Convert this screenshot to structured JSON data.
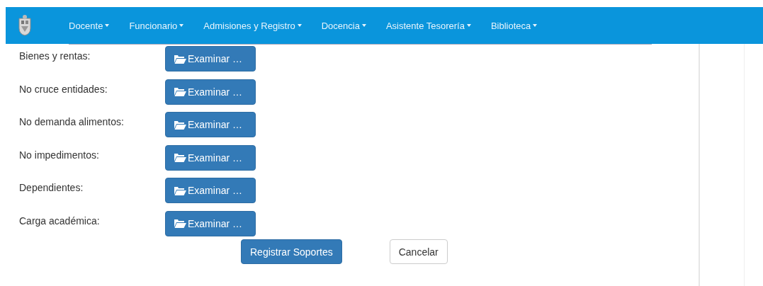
{
  "navbar": {
    "menus": [
      {
        "label": "Docente"
      },
      {
        "label": "Funcionario"
      },
      {
        "label": "Admisiones y Registro"
      },
      {
        "label": "Docencia"
      },
      {
        "label": "Asistente Tesorería"
      },
      {
        "label": "Biblioteca"
      }
    ]
  },
  "form": {
    "rows": [
      {
        "label": "Bienes y rentas:",
        "button": "Examinar …"
      },
      {
        "label": "No cruce entidades:",
        "button": "Examinar …"
      },
      {
        "label": "No demanda alimentos:",
        "button": "Examinar …"
      },
      {
        "label": "No impedimentos:",
        "button": "Examinar …"
      },
      {
        "label": "Dependientes:",
        "button": "Examinar …"
      },
      {
        "label": "Carga académica:",
        "button": "Examinar …"
      }
    ],
    "actions": [
      {
        "label": "Registrar Soportes",
        "kind": "primary"
      },
      {
        "label": "Cancelar",
        "kind": "default"
      }
    ]
  }
}
